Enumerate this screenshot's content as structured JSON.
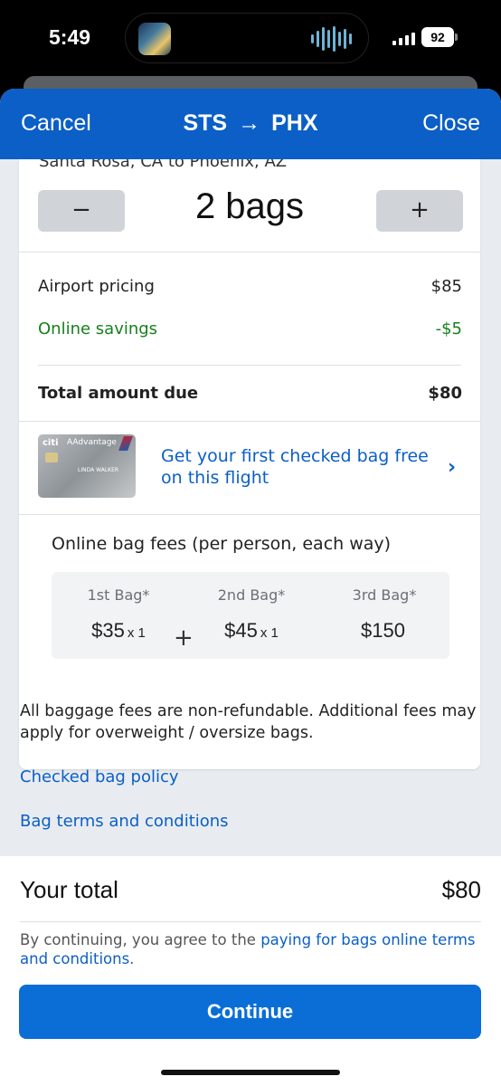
{
  "status_bar": {
    "time": "5:49",
    "battery": "92"
  },
  "header": {
    "cancel_label": "Cancel",
    "origin": "STS",
    "arrow": "→",
    "destination": "PHX",
    "close_label": "Close",
    "color": "#0b5fc7"
  },
  "bags": {
    "route_text": "Santa Rosa, CA to Phoenix, AZ",
    "minus_label": "−",
    "plus_label": "+",
    "count_label": "2 bags"
  },
  "pricing": {
    "airport_label": "Airport pricing",
    "airport_value": "$85",
    "savings_label": "Online savings",
    "savings_value": "-$5",
    "total_label": "Total amount due",
    "total_value": "$80"
  },
  "promo": {
    "card_brand": "citi",
    "card_program": "AAdvantage",
    "card_name": "LINDA WALKER",
    "text": "Get your first checked bag free on this flight",
    "chevron_icon": "chevron-right-icon"
  },
  "fees": {
    "title": "Online bag fees (per person, each way)",
    "items": [
      {
        "label": "1st Bag*",
        "value": "$35",
        "multiplier": "x 1"
      },
      {
        "label": "2nd Bag*",
        "value": "$45",
        "multiplier": "x 1"
      },
      {
        "label": "3rd Bag*",
        "value": "$150",
        "multiplier": ""
      }
    ],
    "plus": "+"
  },
  "info": {
    "disclaimer": "All baggage fees are non-refundable. Additional fees may apply for overweight / oversize bags.",
    "policy_link": "Checked bag policy",
    "terms_link": "Bag terms and conditions"
  },
  "footer": {
    "total_label": "Your total",
    "total_value": "$80",
    "agree_prefix": "By continuing, you agree to the ",
    "agree_link": "paying for bags online terms and conditions",
    "agree_suffix": ".",
    "continue_label": "Continue"
  }
}
